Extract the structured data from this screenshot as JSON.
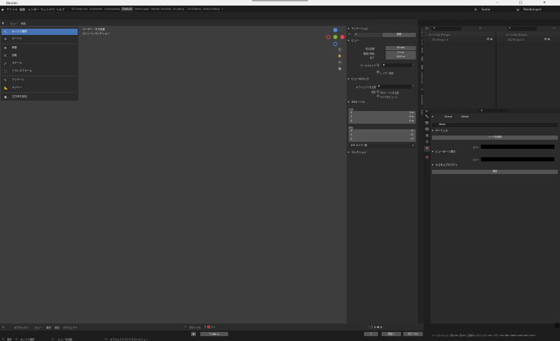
{
  "window": {
    "title": "Blender",
    "controls": [
      "–",
      "□",
      "✕"
    ]
  },
  "menu": {
    "items": [
      "ファイル",
      "編集",
      "レンダー",
      "ウィンドウ",
      "ヘルプ"
    ],
    "workspaces": [
      "3D Snap Ival",
      "Animation",
      "Compositing",
      "Default",
      "Game Logic",
      "Motion Tracking",
      "Scripting",
      "UV Editing",
      "Video Editing",
      "+"
    ],
    "active_workspace": "Default",
    "scene": "Scene",
    "view_layer": "RenderLayer"
  },
  "viewport": {
    "header_items": [
      "ビュー",
      "移動"
    ],
    "info_line1": "ユーザー・平行投影",
    "info_line2": "(1) シーンコレクション",
    "bottom_items": [
      "オブジェクト",
      "ビュー",
      "選択",
      "追加",
      "オブジェクト"
    ],
    "bottom_right": "グローバル"
  },
  "toolbar": {
    "tools": [
      {
        "icon": "↖",
        "label": "ボックス選択",
        "active": true
      },
      {
        "icon": "⊕",
        "label": "カーソル"
      },
      {
        "icon": "✥",
        "label": "移動"
      },
      {
        "icon": "↻",
        "label": "回転"
      },
      {
        "icon": "⤢",
        "label": "スケール"
      },
      {
        "icon": "⬚",
        "label": "トランスフォーム"
      },
      {
        "icon": "✎",
        "label": "アノテート"
      },
      {
        "icon": "📐",
        "label": "メジャー"
      },
      {
        "icon": "▣",
        "label": "立方体を追加"
      }
    ]
  },
  "npanel": {
    "tabs": [
      "アイテム",
      "ツール",
      "ビュー",
      "作成",
      "編集",
      "Screencast",
      "UI",
      "Animation",
      "Rigify",
      "Tool"
    ],
    "annotation": {
      "title": "アノテーション",
      "new_button": "新規"
    },
    "view": {
      "title": "ビュー",
      "focal_label": "焦点距離",
      "focal_value": "50 mm",
      "clip_start_label": "範囲の開始",
      "clip_start_value": "0.1 m",
      "clip_end_label": "終了",
      "clip_end_value": "1000 m",
      "local_camera_label": "ローカルカメラ",
      "render_region_label": "レンダー領域"
    },
    "view_lock": {
      "title": "ビューのロック",
      "object_label": "オブジェクトを注視",
      "lock_label": "固定",
      "to_cursor_label": "3Dカーソルを注視",
      "camera_label": "カメラをビューに"
    },
    "cursor": {
      "title": "3Dカーソル",
      "location_label": "位置:",
      "loc": [
        [
          "X",
          "0 m"
        ],
        [
          "Y",
          "0 m"
        ],
        [
          "Z",
          "0 m"
        ]
      ],
      "rotation_label": "回転:",
      "rot": [
        [
          "X",
          "0°"
        ],
        [
          "Y",
          "0°"
        ],
        [
          "Z",
          "0°"
        ]
      ],
      "mode_value": "XYZ オイラー角"
    },
    "collection": {
      "title": "コレクション"
    }
  },
  "outliner": {
    "left": {
      "root": "シーンコレクション",
      "child": "コレクション 1"
    },
    "right": {
      "root": "シーンコレクション",
      "child": "コレクション 1"
    }
  },
  "properties": {
    "breadcrumb_scene": "Scene",
    "breadcrumb_world": "World",
    "world_name": "World",
    "surface": {
      "title": "サーフェス",
      "use_nodes_button": "ノードを使用",
      "color_label": "カラー"
    },
    "viewport_display": {
      "title": "ビューポート表示",
      "color_label": "カラー"
    },
    "custom_props": {
      "title": "カスタムプロパティ",
      "add_button": "追加"
    }
  },
  "timeline": {
    "start_label": "開始",
    "start_value": "1",
    "end_label": "終了",
    "end_value": "250",
    "current_frame": "1"
  },
  "status": {
    "items": [
      "選択",
      "ボックス選択",
      "ビューを回転",
      "オブジェクトコンテクストメニュー"
    ],
    "stats": "シーンコレクション | 頂点:0/0 | 面:0/0 | 三角面:0 | オブジェクト:0/0 | メモリ: 20.1 MiB | VRAM: 0.6/6.0 GiB | 2.83.5"
  },
  "colors": {
    "accent": "#4772b3",
    "x_axis": "#e0444a",
    "y_axis": "#7ab22d",
    "z_axis": "#4f84d6"
  }
}
